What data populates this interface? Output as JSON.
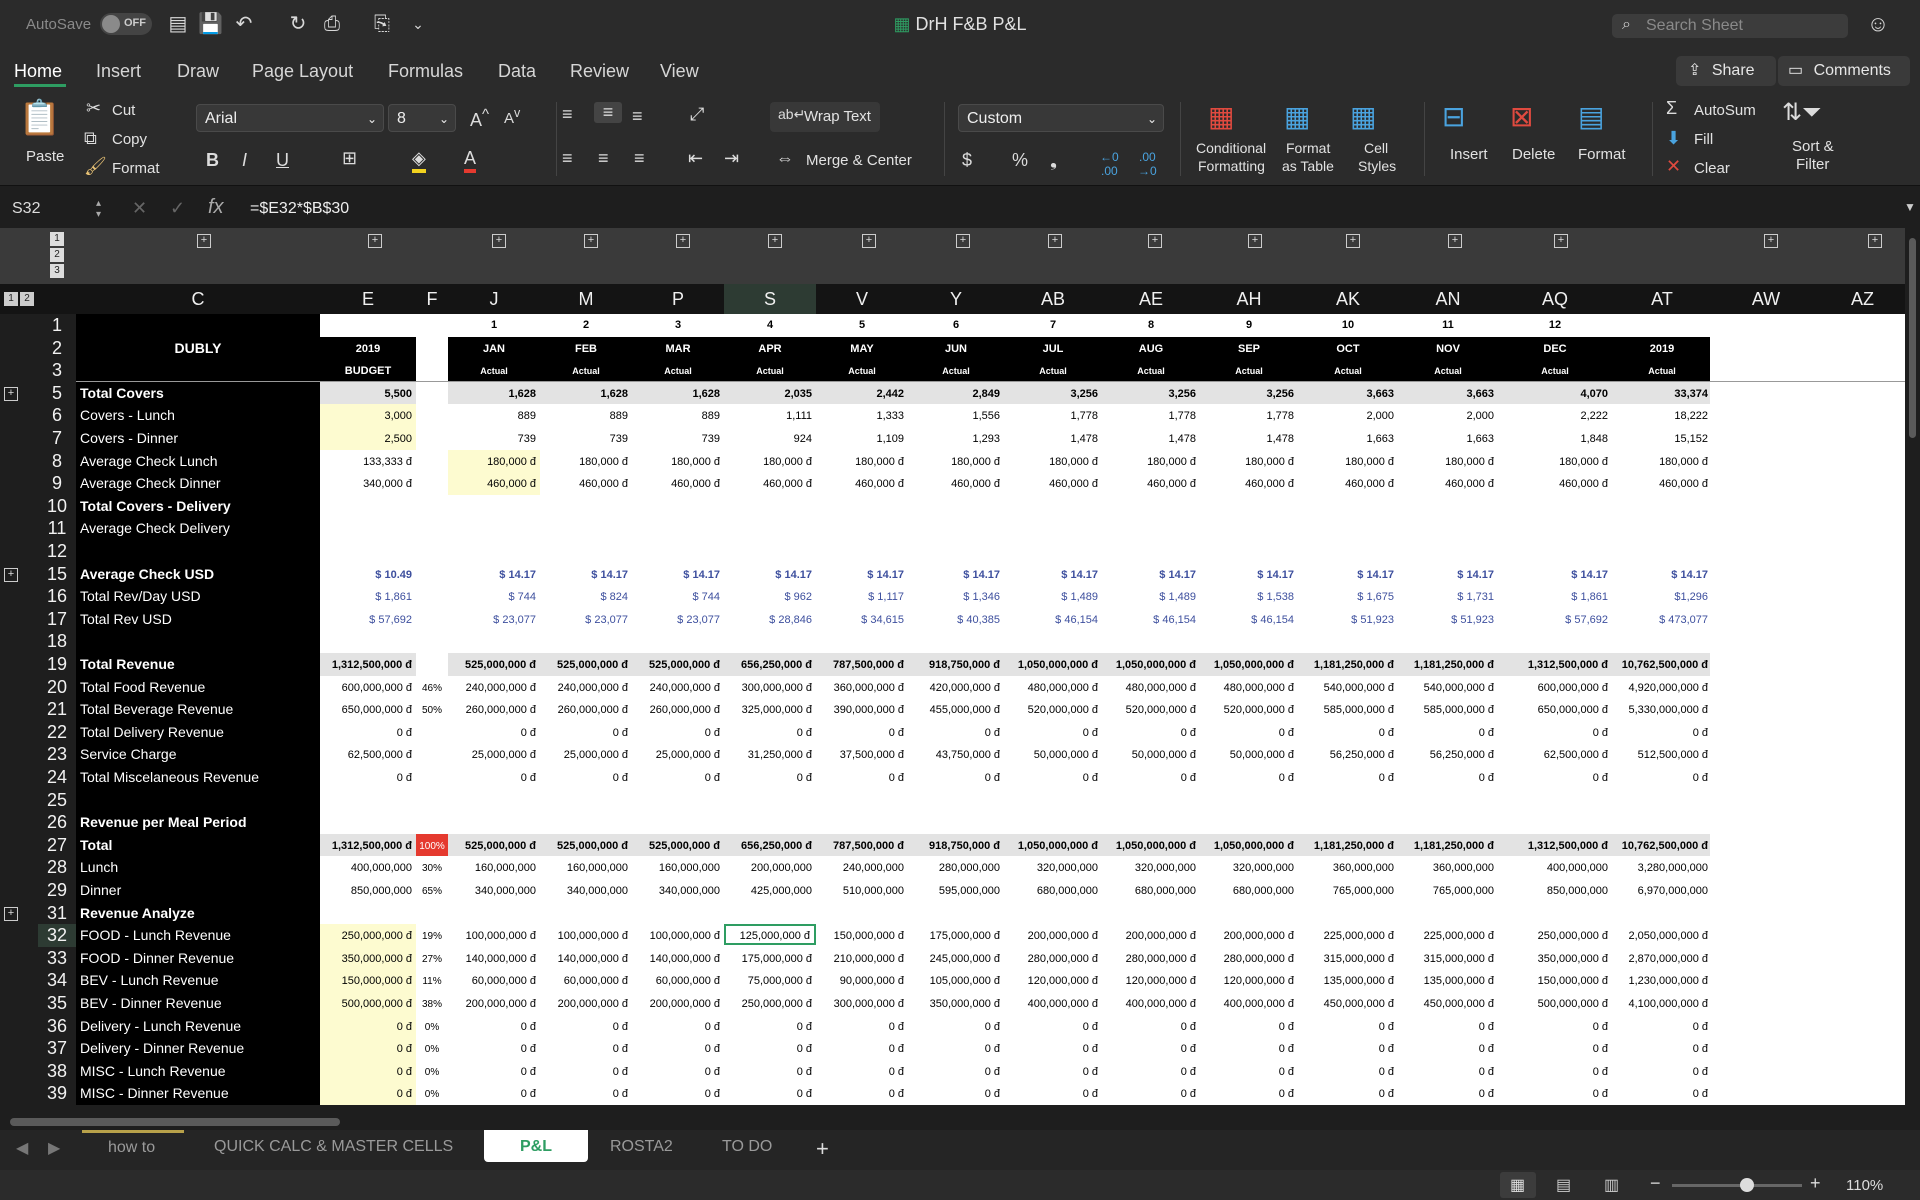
{
  "titlebar": {
    "autosave_label": "AutoSave",
    "autosave_state": "OFF",
    "document_title": "DrH F&B P&L",
    "search_placeholder": "Search Sheet"
  },
  "ribbon_tabs": [
    "Home",
    "Insert",
    "Draw",
    "Page Layout",
    "Formulas",
    "Data",
    "Review",
    "View"
  ],
  "active_tab": "Home",
  "share_label": "Share",
  "comments_label": "Comments",
  "ribbon": {
    "paste": "Paste",
    "cut": "Cut",
    "copy": "Copy",
    "format_painter": "Format",
    "font_name": "Arial",
    "font_size": "8",
    "wrap_text": "Wrap Text",
    "merge_center": "Merge & Center",
    "number_format": "Custom",
    "conditional_formatting": [
      "Conditional",
      "Formatting"
    ],
    "format_as_table": [
      "Format",
      "as Table"
    ],
    "cell_styles": [
      "Cell",
      "Styles"
    ],
    "insert": "Insert",
    "delete": "Delete",
    "format": "Format",
    "autosum": "AutoSum",
    "fill": "Fill",
    "clear": "Clear",
    "sort_filter": [
      "Sort &",
      "Filter"
    ]
  },
  "formula_bar": {
    "name_box": "S32",
    "formula": "=$E32*$B$30"
  },
  "outline_levels": [
    "1",
    "2",
    "3"
  ],
  "col_headers": [
    "C",
    "E",
    "F",
    "J",
    "M",
    "P",
    "S",
    "V",
    "Y",
    "AB",
    "AE",
    "AH",
    "AK",
    "AN",
    "AQ",
    "AT",
    "AW",
    "AZ"
  ],
  "selected_col": "S",
  "row_numbers": [
    "1",
    "2",
    "3",
    "5",
    "6",
    "7",
    "8",
    "9",
    "10",
    "11",
    "12",
    "15",
    "16",
    "17",
    "18",
    "19",
    "20",
    "21",
    "22",
    "23",
    "24",
    "25",
    "26",
    "27",
    "28",
    "29",
    "31",
    "32",
    "33",
    "34",
    "35",
    "36",
    "37",
    "38",
    "39"
  ],
  "selected_row": "32",
  "header_block": {
    "company": "DUBLY",
    "budget_year": "2019",
    "budget_label": "BUDGET",
    "month_numbers": [
      "1",
      "2",
      "3",
      "4",
      "5",
      "6",
      "7",
      "8",
      "9",
      "10",
      "11",
      "12"
    ],
    "months": [
      "JAN",
      "FEB",
      "MAR",
      "APR",
      "MAY",
      "JUN",
      "JUL",
      "AUG",
      "SEP",
      "OCT",
      "NOV",
      "DEC",
      "2019"
    ],
    "actual_label": "Actual"
  },
  "rows": [
    {
      "r": "5",
      "label": "Total Covers",
      "bold": true,
      "budget": "5,500",
      "pct": "",
      "vals": [
        "1,628",
        "1,628",
        "1,628",
        "2,035",
        "2,442",
        "2,849",
        "3,256",
        "3,256",
        "3,256",
        "3,663",
        "3,663",
        "4,070",
        "33,374"
      ],
      "style": "grey"
    },
    {
      "r": "6",
      "label": "Covers - Lunch",
      "budget": "3,000",
      "pct": "",
      "vals": [
        "889",
        "889",
        "889",
        "1,111",
        "1,333",
        "1,556",
        "1,778",
        "1,778",
        "1,778",
        "2,000",
        "2,000",
        "2,222",
        "18,222"
      ],
      "budget_bg": "yellow"
    },
    {
      "r": "7",
      "label": "Covers - Dinner",
      "budget": "2,500",
      "pct": "",
      "vals": [
        "739",
        "739",
        "739",
        "924",
        "1,109",
        "1,293",
        "1,478",
        "1,478",
        "1,478",
        "1,663",
        "1,663",
        "1,848",
        "15,152"
      ],
      "budget_bg": "yellow"
    },
    {
      "r": "8",
      "label": "Average Check Lunch",
      "budget": "133,333 đ",
      "pct": "",
      "vals": [
        "180,000 đ",
        "180,000 đ",
        "180,000 đ",
        "180,000 đ",
        "180,000 đ",
        "180,000 đ",
        "180,000 đ",
        "180,000 đ",
        "180,000 đ",
        "180,000 đ",
        "180,000 đ",
        "180,000 đ",
        "180,000 đ"
      ],
      "first_bg": "yellow"
    },
    {
      "r": "9",
      "label": "Average Check Dinner",
      "budget": "340,000 đ",
      "pct": "",
      "vals": [
        "460,000 đ",
        "460,000 đ",
        "460,000 đ",
        "460,000 đ",
        "460,000 đ",
        "460,000 đ",
        "460,000 đ",
        "460,000 đ",
        "460,000 đ",
        "460,000 đ",
        "460,000 đ",
        "460,000 đ",
        "460,000 đ"
      ],
      "first_bg": "yellow"
    },
    {
      "r": "10",
      "label": "Total Covers - Delivery",
      "bold": true,
      "budget": "",
      "pct": "",
      "vals": []
    },
    {
      "r": "11",
      "label": "Average Check Delivery",
      "budget": "",
      "pct": "",
      "vals": []
    },
    {
      "r": "12",
      "label": "",
      "budget": "",
      "pct": "",
      "vals": []
    },
    {
      "r": "15",
      "label": "Average Check USD",
      "bold": true,
      "budget": "$ 10.49",
      "pct": "",
      "vals": [
        "$ 14.17",
        "$ 14.17",
        "$ 14.17",
        "$ 14.17",
        "$ 14.17",
        "$ 14.17",
        "$ 14.17",
        "$ 14.17",
        "$ 14.17",
        "$ 14.17",
        "$ 14.17",
        "$ 14.17",
        "$ 14.17"
      ],
      "usd": true,
      "valbold": true
    },
    {
      "r": "16",
      "label": "Total Rev/Day USD",
      "budget": "$ 1,861",
      "pct": "",
      "vals": [
        "$ 744",
        "$ 824",
        "$ 744",
        "$ 962",
        "$ 1,117",
        "$ 1,346",
        "$ 1,489",
        "$ 1,489",
        "$ 1,538",
        "$ 1,675",
        "$ 1,731",
        "$ 1,861",
        "$1,296"
      ],
      "usd": true
    },
    {
      "r": "17",
      "label": "Total Rev USD",
      "budget": "$ 57,692",
      "pct": "",
      "vals": [
        "$ 23,077",
        "$ 23,077",
        "$ 23,077",
        "$ 28,846",
        "$ 34,615",
        "$ 40,385",
        "$ 46,154",
        "$ 46,154",
        "$ 46,154",
        "$ 51,923",
        "$ 51,923",
        "$ 57,692",
        "$ 473,077"
      ],
      "usd": true
    },
    {
      "r": "18",
      "label": "",
      "budget": "",
      "pct": "",
      "vals": []
    },
    {
      "r": "19",
      "label": "Total Revenue",
      "bold": true,
      "budget": "1,312,500,000 đ",
      "pct": "",
      "vals": [
        "525,000,000 đ",
        "525,000,000 đ",
        "525,000,000 đ",
        "656,250,000 đ",
        "787,500,000 đ",
        "918,750,000 đ",
        "1,050,000,000 đ",
        "1,050,000,000 đ",
        "1,050,000,000 đ",
        "1,181,250,000 đ",
        "1,181,250,000 đ",
        "1,312,500,000 đ",
        "10,762,500,000 đ"
      ],
      "style": "grey"
    },
    {
      "r": "20",
      "label": "Total Food Revenue",
      "budget": "600,000,000 đ",
      "pct": "46%",
      "vals": [
        "240,000,000 đ",
        "240,000,000 đ",
        "240,000,000 đ",
        "300,000,000 đ",
        "360,000,000 đ",
        "420,000,000 đ",
        "480,000,000 đ",
        "480,000,000 đ",
        "480,000,000 đ",
        "540,000,000 đ",
        "540,000,000 đ",
        "600,000,000 đ",
        "4,920,000,000 đ"
      ]
    },
    {
      "r": "21",
      "label": "Total Beverage Revenue",
      "budget": "650,000,000 đ",
      "pct": "50%",
      "vals": [
        "260,000,000 đ",
        "260,000,000 đ",
        "260,000,000 đ",
        "325,000,000 đ",
        "390,000,000 đ",
        "455,000,000 đ",
        "520,000,000 đ",
        "520,000,000 đ",
        "520,000,000 đ",
        "585,000,000 đ",
        "585,000,000 đ",
        "650,000,000 đ",
        "5,330,000,000 đ"
      ]
    },
    {
      "r": "22",
      "label": "Total Delivery Revenue",
      "budget": "0 đ",
      "pct": "",
      "vals": [
        "0 đ",
        "0 đ",
        "0 đ",
        "0 đ",
        "0 đ",
        "0 đ",
        "0 đ",
        "0 đ",
        "0 đ",
        "0 đ",
        "0 đ",
        "0 đ",
        "0 đ"
      ]
    },
    {
      "r": "23",
      "label": "Service Charge",
      "budget": "62,500,000 đ",
      "pct": "",
      "vals": [
        "25,000,000 đ",
        "25,000,000 đ",
        "25,000,000 đ",
        "31,250,000 đ",
        "37,500,000 đ",
        "43,750,000 đ",
        "50,000,000 đ",
        "50,000,000 đ",
        "50,000,000 đ",
        "56,250,000 đ",
        "56,250,000 đ",
        "62,500,000 đ",
        "512,500,000 đ"
      ]
    },
    {
      "r": "24",
      "label": "Total Miscelaneous Revenue",
      "budget": "0 đ",
      "pct": "",
      "vals": [
        "0 đ",
        "0 đ",
        "0 đ",
        "0 đ",
        "0 đ",
        "0 đ",
        "0 đ",
        "0 đ",
        "0 đ",
        "0 đ",
        "0 đ",
        "0 đ",
        "0 đ"
      ]
    },
    {
      "r": "25",
      "label": "",
      "budget": "",
      "pct": "",
      "vals": []
    },
    {
      "r": "26",
      "label": "Revenue per Meal Period",
      "bold": true,
      "budget": "",
      "pct": "",
      "vals": []
    },
    {
      "r": "27",
      "label": "Total",
      "bold": true,
      "budget": "1,312,500,000 đ",
      "pct": "100%",
      "pct_red": true,
      "vals": [
        "525,000,000 đ",
        "525,000,000 đ",
        "525,000,000 đ",
        "656,250,000 đ",
        "787,500,000 đ",
        "918,750,000 đ",
        "1,050,000,000 đ",
        "1,050,000,000 đ",
        "1,050,000,000 đ",
        "1,181,250,000 đ",
        "1,181,250,000 đ",
        "1,312,500,000 đ",
        "10,762,500,000 đ"
      ],
      "style": "grey"
    },
    {
      "r": "28",
      "label": "Lunch",
      "budget": "400,000,000",
      "pct": "30%",
      "vals": [
        "160,000,000",
        "160,000,000",
        "160,000,000",
        "200,000,000",
        "240,000,000",
        "280,000,000",
        "320,000,000",
        "320,000,000",
        "320,000,000",
        "360,000,000",
        "360,000,000",
        "400,000,000",
        "3,280,000,000"
      ]
    },
    {
      "r": "29",
      "label": "Dinner",
      "budget": "850,000,000",
      "pct": "65%",
      "vals": [
        "340,000,000",
        "340,000,000",
        "340,000,000",
        "425,000,000",
        "510,000,000",
        "595,000,000",
        "680,000,000",
        "680,000,000",
        "680,000,000",
        "765,000,000",
        "765,000,000",
        "850,000,000",
        "6,970,000,000"
      ]
    },
    {
      "r": "31",
      "label": "Revenue Analyze",
      "bold": true,
      "budget": "",
      "pct": "",
      "vals": []
    },
    {
      "r": "32",
      "label": "FOOD - Lunch Revenue",
      "budget": "250,000,000 đ",
      "pct": "19%",
      "vals": [
        "100,000,000 đ",
        "100,000,000 đ",
        "100,000,000 đ",
        "125,000,000 đ",
        "150,000,000 đ",
        "175,000,000 đ",
        "200,000,000 đ",
        "200,000,000 đ",
        "200,000,000 đ",
        "225,000,000 đ",
        "225,000,000 đ",
        "250,000,000 đ",
        "2,050,000,000 đ"
      ],
      "budget_bg": "yellow"
    },
    {
      "r": "33",
      "label": "FOOD - Dinner Revenue",
      "budget": "350,000,000 đ",
      "pct": "27%",
      "vals": [
        "140,000,000 đ",
        "140,000,000 đ",
        "140,000,000 đ",
        "175,000,000 đ",
        "210,000,000 đ",
        "245,000,000 đ",
        "280,000,000 đ",
        "280,000,000 đ",
        "280,000,000 đ",
        "315,000,000 đ",
        "315,000,000 đ",
        "350,000,000 đ",
        "2,870,000,000 đ"
      ],
      "budget_bg": "yellow"
    },
    {
      "r": "34",
      "label": "BEV - Lunch Revenue",
      "budget": "150,000,000 đ",
      "pct": "11%",
      "vals": [
        "60,000,000 đ",
        "60,000,000 đ",
        "60,000,000 đ",
        "75,000,000 đ",
        "90,000,000 đ",
        "105,000,000 đ",
        "120,000,000 đ",
        "120,000,000 đ",
        "120,000,000 đ",
        "135,000,000 đ",
        "135,000,000 đ",
        "150,000,000 đ",
        "1,230,000,000 đ"
      ],
      "budget_bg": "yellow"
    },
    {
      "r": "35",
      "label": "BEV - Dinner Revenue",
      "budget": "500,000,000 đ",
      "pct": "38%",
      "vals": [
        "200,000,000 đ",
        "200,000,000 đ",
        "200,000,000 đ",
        "250,000,000 đ",
        "300,000,000 đ",
        "350,000,000 đ",
        "400,000,000 đ",
        "400,000,000 đ",
        "400,000,000 đ",
        "450,000,000 đ",
        "450,000,000 đ",
        "500,000,000 đ",
        "4,100,000,000 đ"
      ],
      "budget_bg": "yellow"
    },
    {
      "r": "36",
      "label": "Delivery - Lunch Revenue",
      "budget": "0 đ",
      "pct": "0%",
      "vals": [
        "0 đ",
        "0 đ",
        "0 đ",
        "0 đ",
        "0 đ",
        "0 đ",
        "0 đ",
        "0 đ",
        "0 đ",
        "0 đ",
        "0 đ",
        "0 đ",
        "0 đ"
      ],
      "budget_bg": "yellow"
    },
    {
      "r": "37",
      "label": "Delivery - Dinner Revenue",
      "budget": "0 đ",
      "pct": "0%",
      "vals": [
        "0 đ",
        "0 đ",
        "0 đ",
        "0 đ",
        "0 đ",
        "0 đ",
        "0 đ",
        "0 đ",
        "0 đ",
        "0 đ",
        "0 đ",
        "0 đ",
        "0 đ"
      ],
      "budget_bg": "yellow"
    },
    {
      "r": "38",
      "label": "MISC - Lunch Revenue",
      "budget": "0 đ",
      "pct": "0%",
      "vals": [
        "0 đ",
        "0 đ",
        "0 đ",
        "0 đ",
        "0 đ",
        "0 đ",
        "0 đ",
        "0 đ",
        "0 đ",
        "0 đ",
        "0 đ",
        "0 đ",
        "0 đ"
      ],
      "budget_bg": "yellow"
    },
    {
      "r": "39",
      "label": "MISC - Dinner Revenue",
      "budget": "0 đ",
      "pct": "0%",
      "vals": [
        "0 đ",
        "0 đ",
        "0 đ",
        "0 đ",
        "0 đ",
        "0 đ",
        "0 đ",
        "0 đ",
        "0 đ",
        "0 đ",
        "0 đ",
        "0 đ",
        "0 đ"
      ],
      "budget_bg": "yellow"
    }
  ],
  "sheet_tabs": [
    "how to",
    "QUICK CALC & MASTER CELLS",
    "P&L",
    "ROSTA2",
    "TO DO"
  ],
  "active_sheet": "P&L",
  "zoom": "110%",
  "colors": {
    "accent": "#2e9d62",
    "yellow": "#fdfbd0",
    "red": "#e53a2f",
    "usd": "#3d4f9e"
  }
}
